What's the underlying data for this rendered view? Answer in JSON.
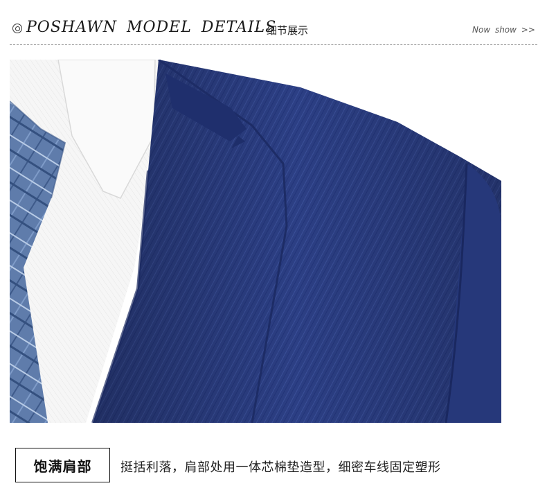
{
  "header": {
    "icon": "circle-target-icon",
    "title": "POSHAWN MODEL DETAILS",
    "separator": "·",
    "subtitle_cn": "细节展示",
    "link": "Now show >>"
  },
  "photo": {
    "subject": "navy suit shoulder with white shirt collar and blue plaid tie",
    "colors": {
      "suit": "#2b3f82",
      "shirt": "#f4f4f4",
      "tie": "#5b79a8",
      "background": "#ffffff"
    }
  },
  "feature": {
    "title": "饱满肩部",
    "description": "挺括利落，肩部处用一体芯棉垫造型，细密车线固定塑形"
  }
}
